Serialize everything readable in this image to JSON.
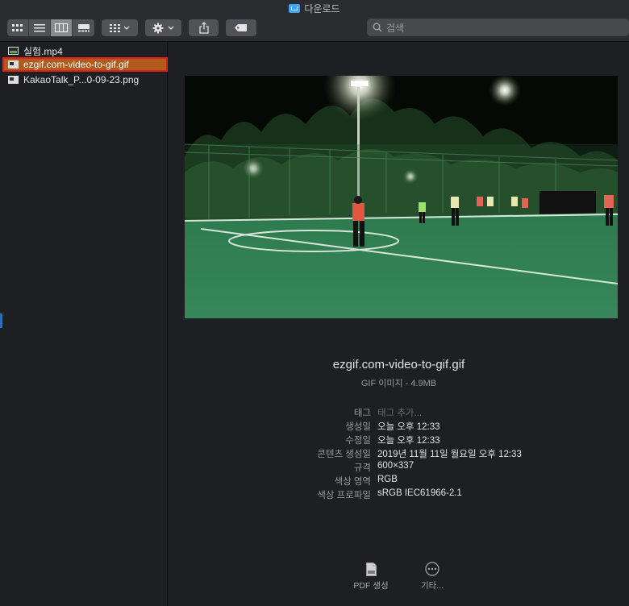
{
  "window": {
    "title": "다운로드"
  },
  "toolbar": {
    "view_icons": [
      "icon-view-icon",
      "list-view-icon",
      "column-view-icon",
      "gallery-view-icon"
    ],
    "active_view": "column-view-icon",
    "group_icon": "group-grid-icon",
    "action_icon": "gear-icon",
    "share_icon": "share-icon",
    "tag_icon": "tag-icon"
  },
  "search": {
    "placeholder": "검색"
  },
  "sidebar": {
    "files": [
      {
        "name": "실험.mp4",
        "icon": "video-file-icon",
        "selected": false
      },
      {
        "name": "ezgif.com-video-to-gif.gif",
        "icon": "image-file-icon",
        "selected": true
      },
      {
        "name": "KakaoTalk_P...0-09-23.png",
        "icon": "image-file-icon",
        "selected": false
      }
    ]
  },
  "preview": {
    "file_name": "ezgif.com-video-to-gif.gif",
    "file_info": "GIF 이미지 - 4.9MB",
    "meta": [
      {
        "key": "태그",
        "value": "태그 추가..."
      },
      {
        "key": "생성일",
        "value": "오늘 오후 12:33"
      },
      {
        "key": "수정일",
        "value": "오늘 오후 12:33"
      },
      {
        "key": "콘텐츠 생성일",
        "value": "2019년 11월 11일 월요일 오후 12:33"
      },
      {
        "key": "규격",
        "value": "600×337"
      },
      {
        "key": "색상 영역",
        "value": "RGB"
      },
      {
        "key": "색상 프로파일",
        "value": "sRGB IEC61966-2.1"
      }
    ],
    "actions": [
      {
        "label": "PDF 생성",
        "icon": "pdf-icon"
      },
      {
        "label": "기타...",
        "icon": "more-icon"
      }
    ]
  },
  "colors": {
    "selection": "#b15a1d",
    "selection_outline": "#e0201b",
    "folder": "#3ea4f3",
    "field": "#2f7f4a"
  }
}
